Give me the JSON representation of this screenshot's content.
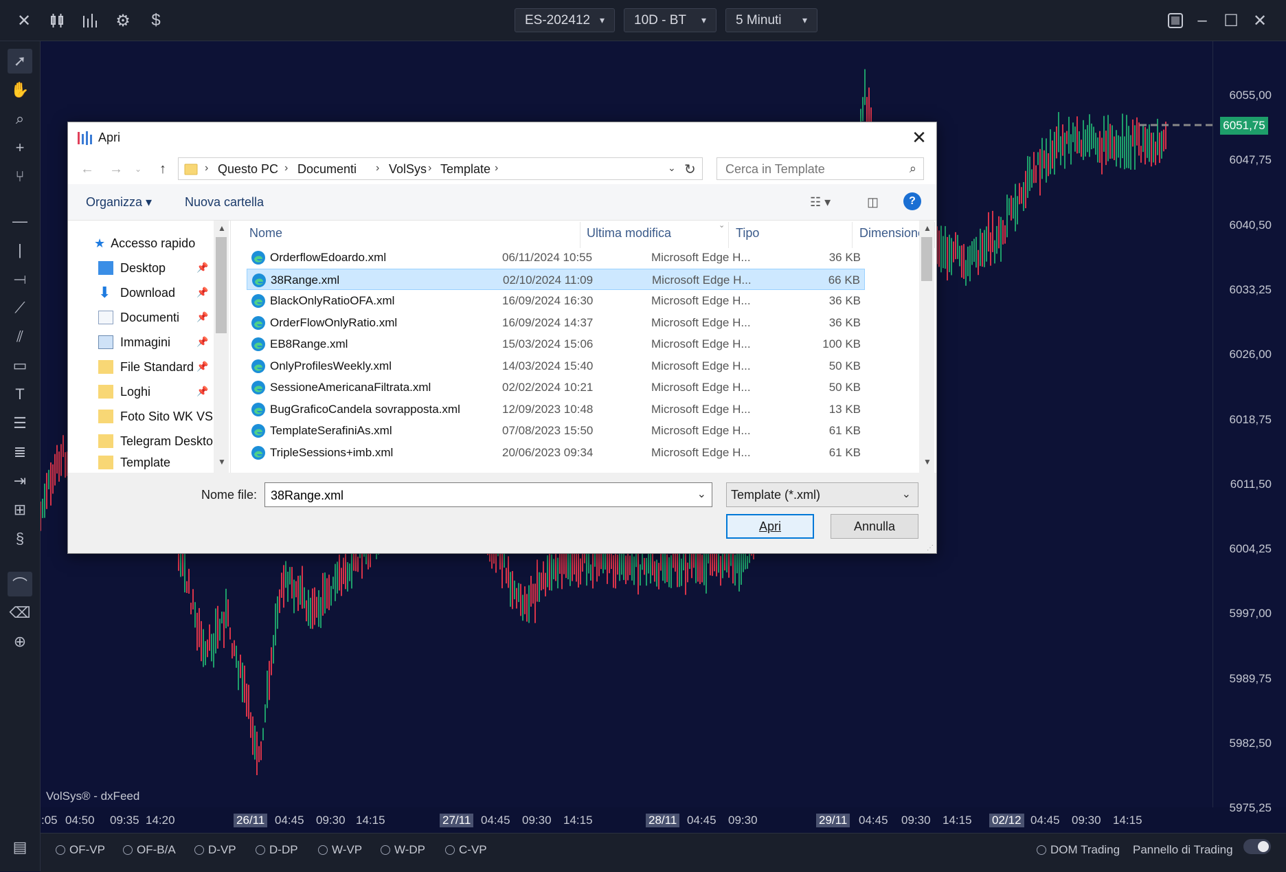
{
  "topbar": {
    "symbol": "ES-202412",
    "range": "10D - BT",
    "timeframe": "5 Minuti"
  },
  "chart": {
    "watermark": "VolSys® - dxFeed",
    "current_price": "6051,75",
    "price_ticks": [
      "6055,00",
      "6047,75",
      "6040,50",
      "6033,25",
      "6026,00",
      "6018,75",
      "6011,50",
      "6004,25",
      "5997,00",
      "5989,75",
      "5982,50",
      "5975,25"
    ],
    "time_ticks": [
      ":05",
      "04:50",
      "09:35",
      "14:20",
      "26/11",
      "04:45",
      "09:30",
      "14:15",
      "27/11",
      "04:45",
      "09:30",
      "14:15",
      "28/11",
      "04:45",
      "09:30",
      "29/11",
      "04:45",
      "09:30",
      "14:15",
      "02/12",
      "04:45",
      "09:30",
      "14:15"
    ]
  },
  "bottombar": {
    "radios": [
      "OF-VP",
      "OF-B/A",
      "D-VP",
      "D-DP",
      "W-VP",
      "W-DP",
      "C-VP"
    ],
    "dom_trading": "DOM Trading",
    "trading_panel": "Pannello di Trading"
  },
  "dialog": {
    "title": "Apri",
    "breadcrumb": [
      "Questo PC",
      "Documenti",
      "VolSys",
      "Template"
    ],
    "search_placeholder": "Cerca in Template",
    "organize": "Organizza",
    "new_folder": "Nuova cartella",
    "nav_items": [
      "Accesso rapido",
      "Desktop",
      "Download",
      "Documenti",
      "Immagini",
      "File Standard",
      "Loghi",
      "Foto Sito WK VS",
      "Telegram Deskto",
      "Template"
    ],
    "columns": {
      "name": "Nome",
      "modified": "Ultima modifica",
      "type": "Tipo",
      "size": "Dimensione"
    },
    "files": [
      {
        "name": "OrderflowEdoardo.xml",
        "modified": "06/11/2024 10:55",
        "type": "Microsoft Edge H...",
        "size": "36 KB"
      },
      {
        "name": "38Range.xml",
        "modified": "02/10/2024 11:09",
        "type": "Microsoft Edge H...",
        "size": "66 KB"
      },
      {
        "name": "BlackOnlyRatioOFA.xml",
        "modified": "16/09/2024 16:30",
        "type": "Microsoft Edge H...",
        "size": "36 KB"
      },
      {
        "name": "OrderFlowOnlyRatio.xml",
        "modified": "16/09/2024 14:37",
        "type": "Microsoft Edge H...",
        "size": "36 KB"
      },
      {
        "name": "EB8Range.xml",
        "modified": "15/03/2024 15:06",
        "type": "Microsoft Edge H...",
        "size": "100 KB"
      },
      {
        "name": "OnlyProfilesWeekly.xml",
        "modified": "14/03/2024 15:40",
        "type": "Microsoft Edge H...",
        "size": "50 KB"
      },
      {
        "name": "SessioneAmericanaFiltrata.xml",
        "modified": "02/02/2024 10:21",
        "type": "Microsoft Edge H...",
        "size": "50 KB"
      },
      {
        "name": "BugGraficoCandela sovrapposta.xml",
        "modified": "12/09/2023 10:48",
        "type": "Microsoft Edge H...",
        "size": "13 KB"
      },
      {
        "name": "TemplateSerafiniAs.xml",
        "modified": "07/08/2023 15:50",
        "type": "Microsoft Edge H...",
        "size": "61 KB"
      },
      {
        "name": "TripleSessions+imb.xml",
        "modified": "20/06/2023 09:34",
        "type": "Microsoft Edge H...",
        "size": "61 KB"
      }
    ],
    "filename_label": "Nome file:",
    "filename_value": "38Range.xml",
    "filetype": "Template (*.xml)",
    "open_button": "Apri",
    "cancel_button": "Annulla"
  },
  "colors": {
    "background": "#0d1236",
    "up": "#1e9e6a",
    "down": "#d8344a",
    "accent": "#0078d7"
  }
}
